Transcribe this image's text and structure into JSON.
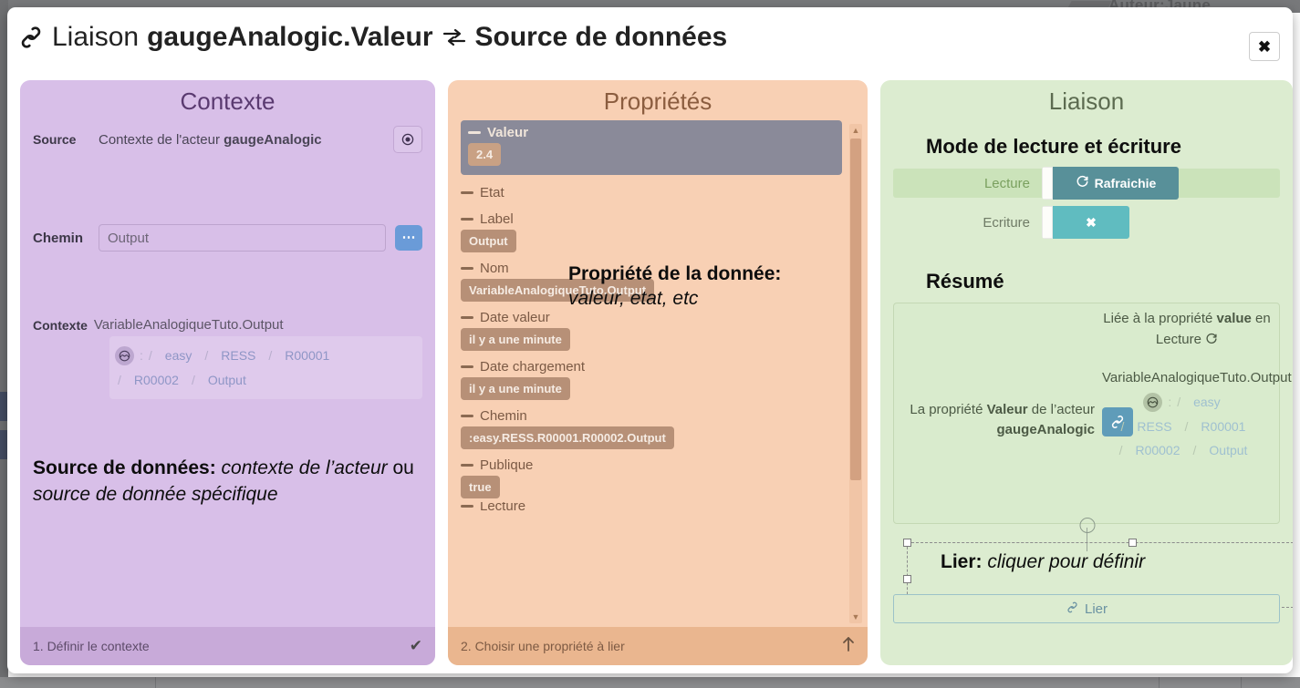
{
  "background": {
    "ghost_text": "Auteur:Jaune"
  },
  "header": {
    "link_icon": "link-icon",
    "title_prefix": "Liaison",
    "title_bold": "gaugeAnalogic.Valeur",
    "swap_icon": "swap-arrows-icon",
    "title_suffix": "Source de données",
    "close_label": "✖"
  },
  "contexte": {
    "title": "Contexte",
    "source_label": "Source",
    "source_value_prefix": "Contexte de l'acteur ",
    "source_value_bold": "gaugeAnalogic",
    "target_icon": "target-icon",
    "chemin_label": "Chemin",
    "chemin_value": "",
    "chemin_placeholder": "Output",
    "ellipsis_button": "⋯",
    "contexte_label": "Contexte",
    "contexte_value": "VariableAnalogiqueTuto.Output",
    "path_icon": "wave-signal-icon",
    "path_segments": [
      "easy",
      "RESS",
      "R00001",
      "R00002",
      "Output"
    ],
    "path_colon": ":",
    "path_separator": "/",
    "annotation_bold": "Source de données:",
    "annotation_italic1": " contexte de l’acteur",
    "annotation_mid": " ou ",
    "annotation_italic2": "source de donnée spécifique",
    "footer_text": "1. Définir le contexte",
    "footer_icon": "check-icon",
    "footer_glyph": "✔"
  },
  "proprietes": {
    "title": "Propriétés",
    "items": [
      {
        "name": "Valeur",
        "value": "2.4",
        "selected": true
      },
      {
        "name": "Etat",
        "value": null,
        "selected": false
      },
      {
        "name": "Label",
        "value": "Output",
        "selected": false
      },
      {
        "name": "Nom",
        "value": "VariableAnalogiqueTuto.Output",
        "selected": false
      },
      {
        "name": "Date valeur",
        "value": "il y a une minute",
        "selected": false
      },
      {
        "name": "Date chargement",
        "value": "il y a une minute",
        "selected": false
      },
      {
        "name": "Chemin",
        "value": ":easy.RESS.R00001.R00002.Output",
        "selected": false
      },
      {
        "name": "Publique",
        "value": "true",
        "selected": false
      }
    ],
    "cut_off_item": "Lecture",
    "annotation_bold": "Propriété de la donnée:",
    "annotation_italic": "valeur, etat, etc",
    "footer_text": "2. Choisir une propriété à lier",
    "footer_icon": "arrow-up-icon",
    "footer_glyph": "⬆",
    "scrollbar_up_icon": "chevron-up-icon",
    "scrollbar_down_icon": "chevron-down-icon"
  },
  "liaison": {
    "title": "Liaison",
    "mode_heading": "Mode de lecture et écriture",
    "lecture_label": "Lecture",
    "lecture_toggle_text": "Rafraichie",
    "lecture_toggle_icon": "refresh-icon",
    "ecriture_label": "Ecriture",
    "ecriture_toggle_text": "✖",
    "ecriture_toggle_icon": "cross-icon",
    "resume_heading": "Résumé",
    "resume_left_prefix": "La propriété ",
    "resume_left_bold1": "Valeur",
    "resume_left_mid": " de l’acteur ",
    "resume_left_bold2": "gaugeAnalogic",
    "resume_link_icon": "link-icon",
    "resume_right_line1_prefix": "Liée à la propriété ",
    "resume_right_line1_bold": "value",
    "resume_right_line1_mid": " en Lecture ",
    "resume_right_line1_icon": "refresh-icon",
    "resume_right_path_title": "VariableAnalogiqueTuto.Output",
    "path_icon": "wave-signal-icon",
    "path_colon": ":",
    "path_separator": "/",
    "path_segments": [
      "easy",
      "RESS",
      "R00001",
      "R00002",
      "Output"
    ],
    "annotation_bold": "Lier:",
    "annotation_italic": " cliquer pour définir",
    "lier_button_label": "Lier",
    "lier_button_icon": "link-icon",
    "rotate_handle_icon": "rotate-handle-icon"
  },
  "colors": {
    "contexte_bg": "#d8bfe8",
    "proprietes_bg": "#f8d0b4",
    "liaison_bg": "#dcecd0",
    "selected_prop_bg": "#8a8a99",
    "prop_value_bg": "#b79077",
    "toggle_read": "#589099",
    "toggle_write": "#60bcc0",
    "blue_button": "#6a9bd8",
    "link_button": "#5f9cb9"
  }
}
